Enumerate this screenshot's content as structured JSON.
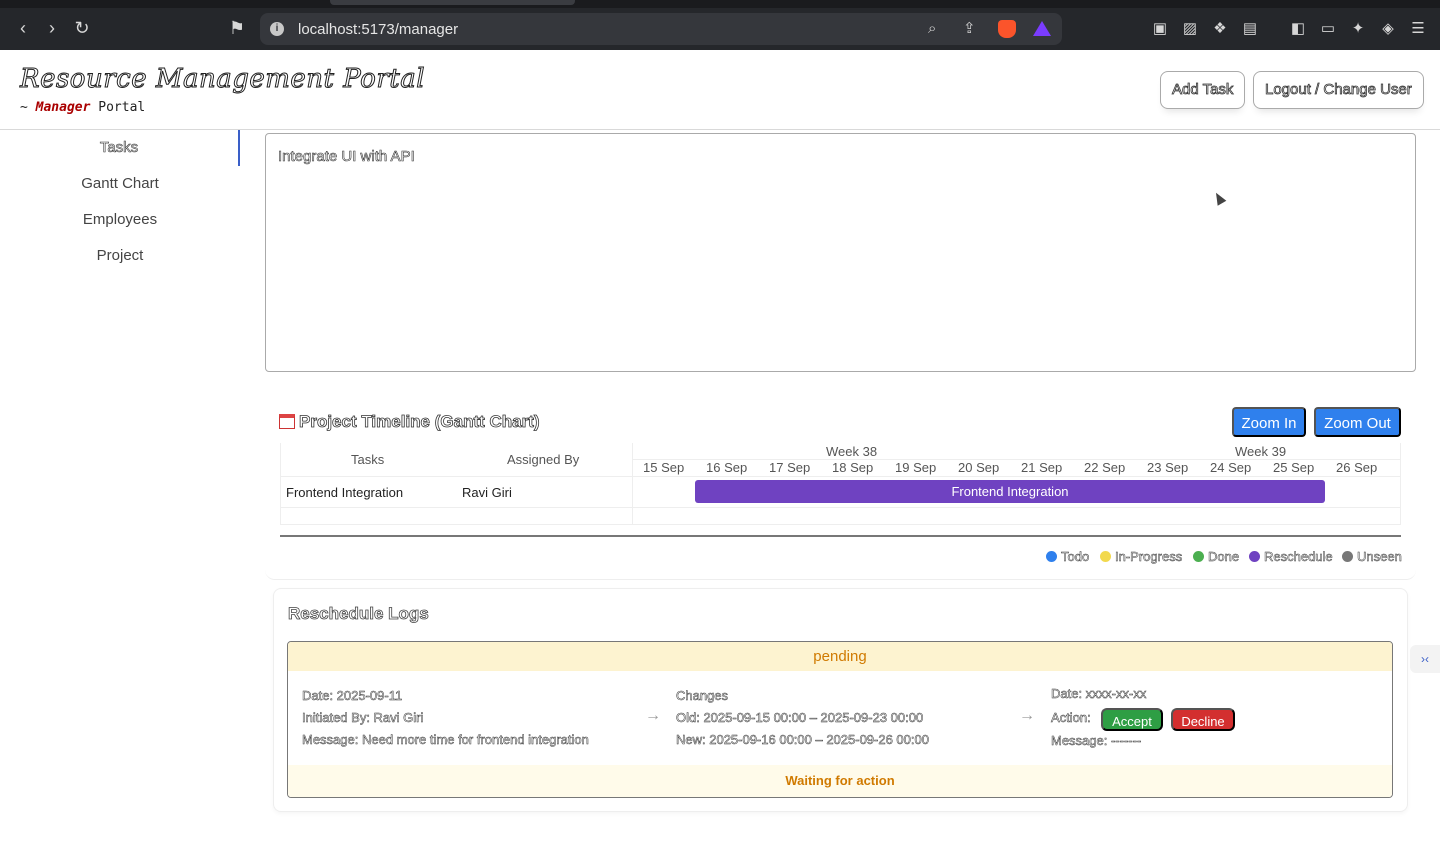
{
  "browser": {
    "url": "localhost:5173/manager"
  },
  "header": {
    "title": "Resource Management Portal",
    "subtitle_prefix": "~",
    "subtitle_role": "Manager",
    "subtitle_suffix": "Portal",
    "add_task_label": "Add Task",
    "logout_label": "Logout / Change User"
  },
  "sidebar": {
    "items": [
      {
        "label": "Tasks"
      },
      {
        "label": "Gantt Chart"
      },
      {
        "label": "Employees"
      },
      {
        "label": "Project"
      }
    ]
  },
  "task_description": "Integrate UI with API",
  "gantt": {
    "title": "Project Timeline (Gantt Chart)",
    "zoom_in_label": "Zoom In",
    "zoom_out_label": "Zoom Out",
    "col_tasks": "Tasks",
    "col_assigned_by": "Assigned By",
    "weeks": [
      "Week 38",
      "Week 39"
    ],
    "days": [
      "15 Sep",
      "16 Sep",
      "17 Sep",
      "18 Sep",
      "19 Sep",
      "20 Sep",
      "21 Sep",
      "22 Sep",
      "23 Sep",
      "24 Sep",
      "25 Sep",
      "26 Sep"
    ],
    "rows": [
      {
        "task": "Frontend Integration",
        "assigned_by": "Ravi Giri",
        "bar_label": "Frontend Integration",
        "start_day": "16 Sep",
        "end_day": "25 Sep",
        "color": "#6f42c1"
      }
    ],
    "legend": [
      {
        "label": "Todo",
        "color": "#2f80ed"
      },
      {
        "label": "In-Progress",
        "color": "#f2d94e"
      },
      {
        "label": "Done",
        "color": "#4caf50"
      },
      {
        "label": "Reschedule",
        "color": "#6f42c1"
      },
      {
        "label": "Unseen",
        "color": "#777777"
      }
    ]
  },
  "logs": {
    "title": "Reschedule Logs",
    "entry": {
      "status": "pending",
      "date": "Date: 2025-09-11",
      "initiated_by": "Initiated By: Ravi Giri",
      "message": "Message: Need more time for frontend integration",
      "changes_heading": "Changes",
      "old": "Old: 2025-09-15 00:00 – 2025-09-23 00:00",
      "new": "New: 2025-09-16 00:00 – 2025-09-26 00:00",
      "resp_date": "Date: xxxx-xx-xx",
      "action_label": "Action:",
      "accept_label": "Accept",
      "decline_label": "Decline",
      "resp_message": "Message: -------",
      "footer": "Waiting for action"
    }
  }
}
